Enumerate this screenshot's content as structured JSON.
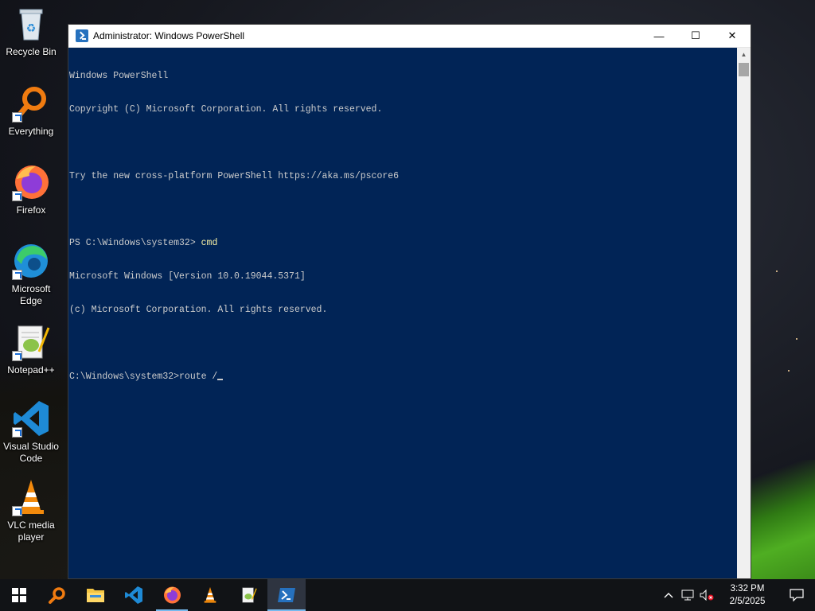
{
  "desktop": {
    "icons": [
      {
        "label": "Recycle Bin",
        "icon": "recycle-bin-icon"
      },
      {
        "label": "Everything",
        "icon": "everything-search-icon"
      },
      {
        "label": "Firefox",
        "icon": "firefox-icon"
      },
      {
        "label": "Microsoft Edge",
        "icon": "edge-icon"
      },
      {
        "label": "Notepad++",
        "icon": "notepadpp-icon"
      },
      {
        "label": "Visual Studio Code",
        "icon": "vscode-icon"
      },
      {
        "label": "VLC media player",
        "icon": "vlc-icon"
      }
    ]
  },
  "window": {
    "title": "Administrator: Windows PowerShell",
    "minimize": "—",
    "maximize": "☐",
    "close": "✕",
    "console_lines": [
      "Windows PowerShell",
      "Copyright (C) Microsoft Corporation. All rights reserved.",
      "",
      "Try the new cross-platform PowerShell https://aka.ms/pscore6",
      "",
      "PS C:\\Windows\\system32> ",
      "Microsoft Windows [Version 10.0.19044.5371]",
      "(c) Microsoft Corporation. All rights reserved.",
      "",
      "C:\\Windows\\system32>route /"
    ],
    "ps_command": "cmd",
    "colors": {
      "background": "#012456",
      "text": "#cccccc",
      "command": "#f9f1a5"
    }
  },
  "taskbar": {
    "apps": [
      "start-icon",
      "everything-search-icon",
      "file-explorer-icon",
      "vscode-icon",
      "firefox-icon",
      "vlc-icon",
      "notepadpp-icon",
      "powershell-icon"
    ],
    "time": "3:32 PM",
    "date": "2/5/2025",
    "tray": [
      "chevron-up-icon",
      "network-icon",
      "volume-muted-icon",
      "notification-icon"
    ]
  }
}
